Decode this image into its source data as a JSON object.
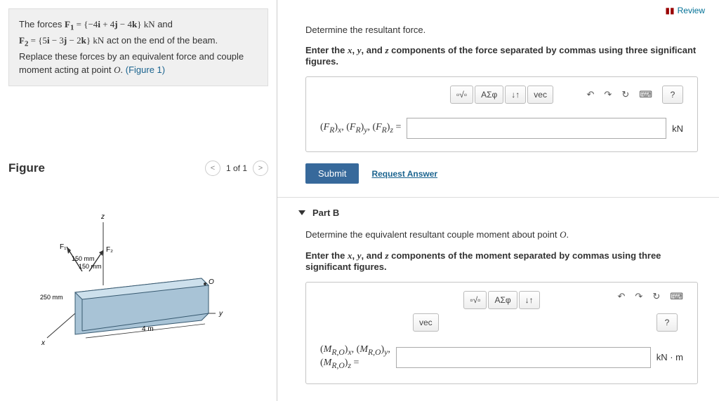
{
  "review": "Review",
  "problem": {
    "line1_pre": "The forces ",
    "f1_label": "F₁",
    "f1_expr": " = {−4i + 4j − 4k} kN",
    "line1_mid": " and",
    "f2_label": "F₂",
    "f2_expr": " = {5i − 3j − 2k} kN",
    "line2_rest": " act on the end of the beam.",
    "line3": "Replace these forces by an equivalent force and couple moment acting at point ",
    "pointO": "O",
    "figure_link": "(Figure 1)"
  },
  "figure": {
    "title": "Figure",
    "counter": "1 of 1",
    "labels": {
      "f1": "F₁",
      "f2": "F₂",
      "d1": "150 mm",
      "d2": "150 mm",
      "d3": "250 mm",
      "d4": "4 m",
      "x": "x",
      "y": "y",
      "z": "z",
      "o": "O"
    }
  },
  "partA": {
    "instruction": "Determine the resultant force.",
    "sub_pre": "Enter the ",
    "sub_mid": " components of the force separated by commas using three significant figures.",
    "var_label": "(F_R)_x, (F_R)_y, (F_R)_z =",
    "unit": "kN",
    "submit": "Submit",
    "request": "Request Answer"
  },
  "partB": {
    "title": "Part B",
    "instruction": "Determine the equivalent resultant couple moment about point ",
    "pointO": "O",
    "sub_pre": "Enter the ",
    "sub_mid": " components of the moment separated by commas using three significant figures.",
    "var_label": "(M_{R,O})_x, (M_{R,O})_y, (M_{R,O})_z =",
    "unit": "kN · m"
  },
  "tools": {
    "templates": "▫√▫",
    "greek": "ΑΣφ",
    "updown": "↓↑",
    "vec": "vec",
    "undo": "↶",
    "redo": "↷",
    "reset": "↻",
    "keyboard": "⌨",
    "help": "?"
  },
  "xyz": {
    "x": "x",
    "y": "y",
    "z": "z",
    "and": ", and "
  }
}
